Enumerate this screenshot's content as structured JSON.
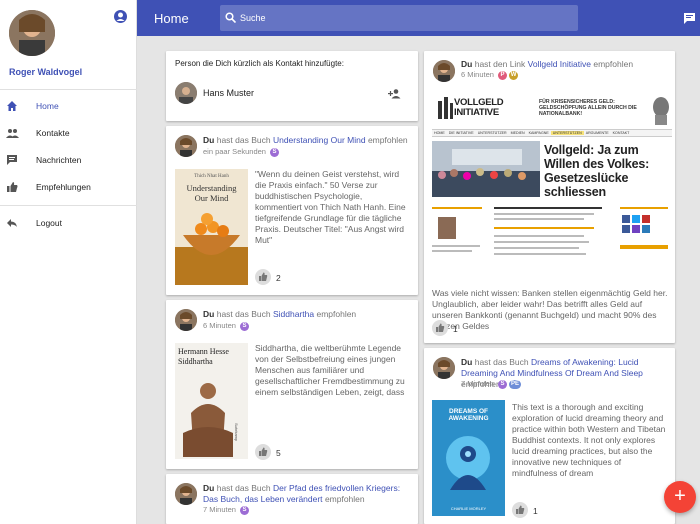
{
  "sidebar": {
    "user_name": "Roger Waldvogel",
    "items": [
      {
        "label": "Home",
        "icon": "home-icon"
      },
      {
        "label": "Kontakte",
        "icon": "people-icon"
      },
      {
        "label": "Nachrichten",
        "icon": "chat-icon"
      },
      {
        "label": "Empfehlungen",
        "icon": "thumb-up-icon"
      },
      {
        "label": "Logout",
        "icon": "reply-icon"
      }
    ]
  },
  "header": {
    "title": "Home",
    "search_placeholder": "Suche"
  },
  "contact_card": {
    "title": "Person die Dich kürzlich als Kontakt hinzufügte:",
    "name": "Hans Muster"
  },
  "feed_left": [
    {
      "who": "Du",
      "verb": "hast das Buch",
      "title": "Understanding Our Mind",
      "suffix": "empfohlen",
      "time": "ein paar Sekunden",
      "badges": [
        "S"
      ],
      "cover_title": "Understanding Our Mind",
      "cover_author": "Thich Nhat Hanh",
      "description": "\"Wenn du deinen Geist verstehst, wird die Praxis einfach.\" 50 Verse zur buddhistischen Psychologie, kommentiert von Thich Nath Hanh. Eine tiefgreifende Grundlage für die tägliche Praxis. Deutscher Titel: \"Aus Angst wird Mut\"",
      "likes": "2"
    },
    {
      "who": "Du",
      "verb": "hast das Buch",
      "title": "Siddhartha",
      "suffix": "empfohlen",
      "time": "6 Minuten",
      "badges": [
        "S"
      ],
      "cover_title": "Hermann Hesse Siddhartha",
      "cover_author": "Suhrkamp",
      "description": "Siddhartha, die weltberühmte Legende von der Selbstbefreiung eines jungen Menschen aus familiärer und gesellschaftlicher Fremdbestimmung zu einem selbständigen Leben, zeigt, dass Erkenntnis nicht aus Lehren zu vermitteln ist, sondern nur durch",
      "likes": "5"
    },
    {
      "who": "Du",
      "verb": "hast das Buch",
      "title": "Der Pfad des friedvollen Kriegers: Das Buch, das Leben verändert",
      "suffix": "empfohlen",
      "time": "7 Minuten",
      "badges": [
        "S"
      ]
    }
  ],
  "feed_right": [
    {
      "who": "Du",
      "verb": "hast den Link",
      "title": "Vollgeld Initiative",
      "suffix": "empfohlen",
      "time": "6 Minuten",
      "badges": [
        "P",
        "W"
      ],
      "site_logo": "VOLLGELD INITIATIVE",
      "site_tagline": "FÜR KRISENSICHERES GELD: GELDSCHÖPFUNG ALLEIN DURCH DIE NATIONALBANK!",
      "headline": "Vollgeld: Ja zum Willen des Volkes: Gesetzeslücke schliessen",
      "nav_items": [
        "HOME",
        "DIE INITIATIVE",
        "UNTERSTÜTZER",
        "MEDIEN",
        "KAMPAGNE",
        "UNTERSTÜTZEN",
        "ARGUMENTE",
        "KONTAKT"
      ],
      "description": "Was viele nicht wissen: Banken stellen eigenmächtig Geld her. Unglaublich, aber leider wahr! Das betrifft alles Geld auf unseren Bankkonti (genannt Buchgeld) und macht 90% des ganzen Geldes",
      "likes": "1"
    },
    {
      "who": "Du",
      "verb": "hast das Buch",
      "title": "Dreams of Awakening: Lucid Dreaming And Mindfulness Of Dream And Sleep",
      "suffix": "empfohlen",
      "time": "7 Minuten",
      "badges": [
        "S",
        "PE"
      ],
      "cover_title": "DREAMS OF AWAKENING",
      "cover_author": "CHARLIE MORLEY",
      "description": "This text is a thorough and exciting exploration of lucid dreaming theory and practice within both Western and Tibetan Buddhist contexts. It not only explores lucid dreaming practices, but also the innovative new techniques of mindfulness of dream",
      "likes": "1"
    }
  ],
  "colors": {
    "primary": "#3f51b5",
    "accent": "#f44336",
    "badge_s": "#9c6cd4",
    "badge_p": "#e05a7a",
    "badge_w": "#c8a02a",
    "badge_pe": "#6f8fd8"
  },
  "fab_label": "+"
}
